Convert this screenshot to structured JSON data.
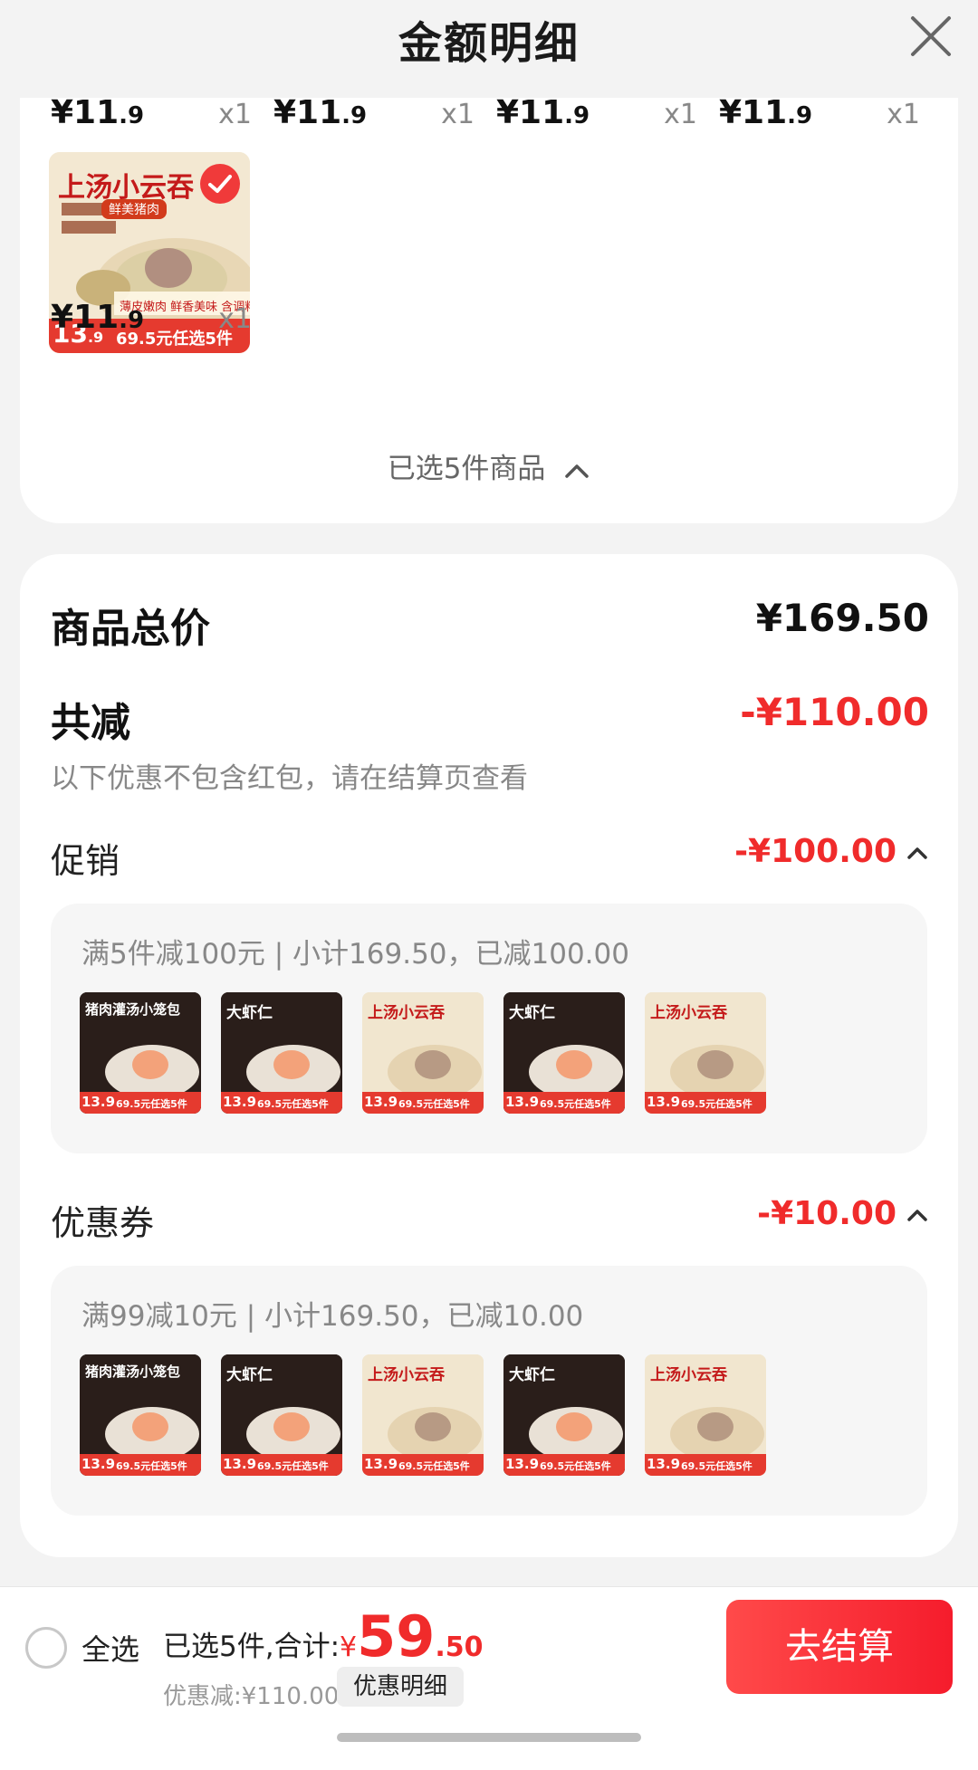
{
  "header": {
    "title": "金额明细"
  },
  "items_row1": [
    {
      "price_int": "¥11",
      "price_dec": ".9",
      "qty": "x1"
    },
    {
      "price_int": "¥11",
      "price_dec": ".9",
      "qty": "x1"
    },
    {
      "price_int": "¥11",
      "price_dec": ".9",
      "qty": "x1"
    },
    {
      "price_int": "¥11",
      "price_dec": ".9",
      "qty": "x1"
    }
  ],
  "item5": {
    "title": "上汤小云吞",
    "subtitle": "鲜美猪肉",
    "badge_big": "13",
    "badge_small": ".9",
    "banner": "69.5元任选5件",
    "tagline": "薄皮嫩肉 鲜香美味 含调料包",
    "price_int": "¥11",
    "price_dec": ".9",
    "qty": "x1"
  },
  "selected_count": "已选5件商品",
  "summary": {
    "total_label": "商品总价",
    "total_value": "¥169.50",
    "reduce_label": "共减",
    "reduce_value": "-¥110.00",
    "note": "以下优惠不包含红包，请在结算页查看"
  },
  "promo": {
    "label": "促销",
    "value": "-¥100.00",
    "desc": "满5件减100元 | 小计169.50，已减100.00"
  },
  "coupon": {
    "label": "优惠券",
    "value": "-¥10.00",
    "desc": "满99减10元 | 小计169.50，已减10.00"
  },
  "product_thumbs": [
    {
      "title": "猪肉灌汤小笼包",
      "theme": "dark",
      "badge": "13.9",
      "banner": "69.5元任选5件"
    },
    {
      "title": "大虾仁",
      "theme": "dark",
      "badge": "13.9",
      "banner": "69.5元任选5件"
    },
    {
      "title": "上汤小云吞",
      "theme": "light",
      "badge": "13.9",
      "banner": "69.5元任选5件"
    },
    {
      "title": "大虾仁",
      "theme": "dark",
      "badge": "13.9",
      "banner": "69.5元任选5件"
    },
    {
      "title": "上汤小云吞",
      "theme": "light",
      "badge": "13.9",
      "banner": "69.5元任选5件"
    }
  ],
  "bottom": {
    "select_all": "全选",
    "selected_text": "已选5件,合计:",
    "yen": "¥",
    "total_big": "59",
    "total_cents": ".50",
    "discount_text": "优惠减:¥110.00",
    "detail_btn": "优惠明细",
    "checkout": "去结算"
  },
  "colors": {
    "accent": "#f02b2b",
    "background": "#f3f3f3"
  }
}
